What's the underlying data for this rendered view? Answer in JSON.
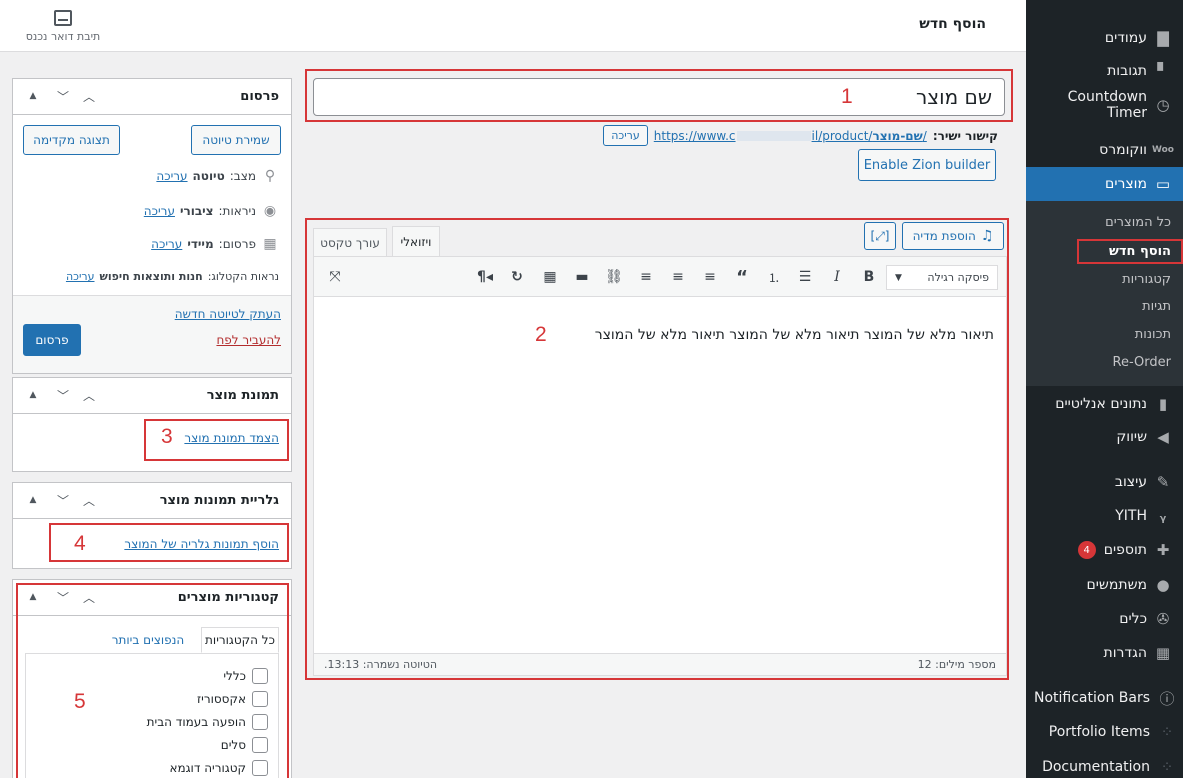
{
  "header": {
    "page_title": "הוסף חדש",
    "inbox_label": "תיבת דואר נכנס"
  },
  "sidebar": {
    "items": [
      {
        "label": "עמודים",
        "icon": "pages-icon"
      },
      {
        "label": "תגובות",
        "icon": "comments-icon"
      },
      {
        "label": "Countdown Timer",
        "icon": "clock-icon"
      },
      {
        "label": "ווקומרס",
        "icon": "woo-icon"
      },
      {
        "label": "מוצרים",
        "icon": "archive-icon"
      },
      {
        "label": "נתונים אנליטיים",
        "icon": "chart-icon"
      },
      {
        "label": "שיווק",
        "icon": "megaphone-icon"
      },
      {
        "label": "עיצוב",
        "icon": "brush-icon"
      },
      {
        "label": "YITH",
        "icon": "yith-icon"
      },
      {
        "label": "תוספים",
        "icon": "plugin-icon",
        "badge": "4"
      },
      {
        "label": "משתמשים",
        "icon": "user-icon"
      },
      {
        "label": "כלים",
        "icon": "wrench-icon"
      },
      {
        "label": "הגדרות",
        "icon": "settings-icon"
      },
      {
        "label": "Notification Bars",
        "icon": "info-icon"
      },
      {
        "label": "Portfolio Items",
        "icon": "grid-icon"
      },
      {
        "label": "Documentation",
        "icon": "grid-icon"
      }
    ],
    "products_submenu": [
      "כל המוצרים",
      "הוסף חדש",
      "קטגוריות",
      "תגיות",
      "תכונות",
      "Re-Order"
    ]
  },
  "title": {
    "value": "שם מוצר"
  },
  "permalink": {
    "label": "קישור ישיר:",
    "url_prefix": "https://www.c",
    "url_suffix": "il/product/",
    "slug": "שם-מוצר",
    "edit_label": "עריכה"
  },
  "zion_button": "Enable Zion builder",
  "editor": {
    "add_media": "הוספת מדיה",
    "tab_visual": "ויזואלי",
    "tab_text": "עורך טקסט",
    "format_select": "פיסקה רגילה",
    "content": "תיאור מלא של המוצר תיאור מלא של המוצר תיאור מלא של המוצר",
    "word_count": "מספר מילים: 12",
    "saved_at": "הטיוטה נשמרה: 13:13."
  },
  "annotations": [
    "1",
    "2",
    "3",
    "4",
    "5"
  ],
  "publish_box": {
    "title": "פרסום",
    "save_draft": "שמירת טיוטה",
    "preview": "תצוגה מקדימה",
    "status_label": "מצב:",
    "status_value": "טיוטה",
    "visibility_label": "ניראות:",
    "visibility_value": "ציבורי",
    "publish_label": "פרסום:",
    "publish_value": "מיידי",
    "catalog_label": "נראות הקטלוג:",
    "catalog_value": "חנות ותוצאות חיפוש",
    "edit_link": "עריכה",
    "copy_draft": "העתק לטיוטה חדשה",
    "trash": "להעביר לפח",
    "publish_button": "פרסום"
  },
  "image_box": {
    "title": "תמונת מוצר",
    "link": "הצמד תמונת מוצר"
  },
  "gallery_box": {
    "title": "גלריית תמונות מוצר",
    "link": "הוסף תמונות גלריה של המוצר"
  },
  "categories_box": {
    "title": "קטגוריות מוצרים",
    "tab_all": "כל הקטגוריות",
    "tab_popular": "הנפוצים ביותר",
    "items": [
      "כללי",
      "אקססוריז",
      "הופעה בעמוד הבית",
      "סלים",
      "קטגוריה דוגמא"
    ]
  },
  "colors": {
    "accent": "#2271b1",
    "sidebar_bg": "#1d2327",
    "annotation_red": "#d63638"
  }
}
